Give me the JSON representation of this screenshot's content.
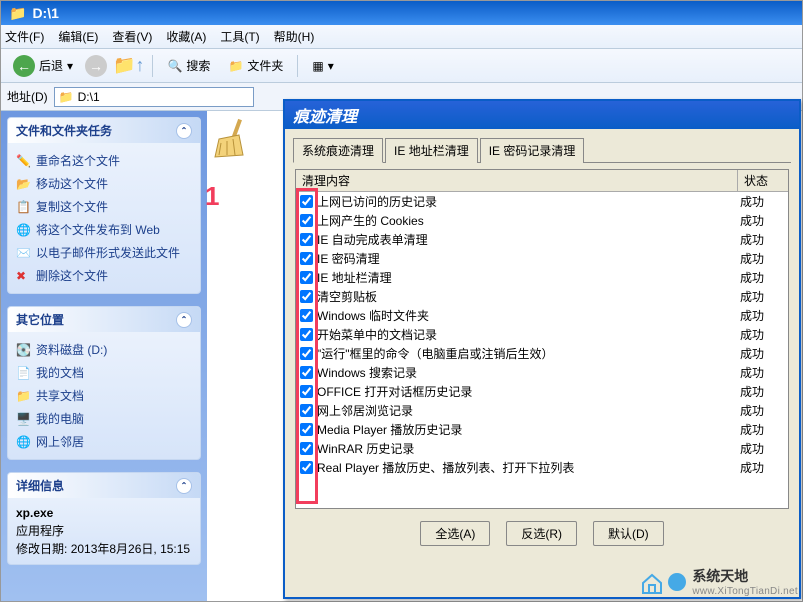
{
  "window": {
    "title": "D:\\1"
  },
  "menu": {
    "file": "文件(F)",
    "edit": "编辑(E)",
    "view": "查看(V)",
    "favorites": "收藏(A)",
    "tools": "工具(T)",
    "help": "帮助(H)"
  },
  "toolbar": {
    "back": "后退",
    "search": "搜索",
    "folders": "文件夹"
  },
  "addressbar": {
    "label": "地址(D)",
    "value": "D:\\1"
  },
  "sidebar": {
    "tasks": {
      "title": "文件和文件夹任务",
      "items": [
        {
          "icon": "rename-icon",
          "label": "重命名这个文件"
        },
        {
          "icon": "move-icon",
          "label": "移动这个文件"
        },
        {
          "icon": "copy-icon",
          "label": "复制这个文件"
        },
        {
          "icon": "web-icon",
          "label": "将这个文件发布到 Web"
        },
        {
          "icon": "email-icon",
          "label": "以电子邮件形式发送此文件"
        },
        {
          "icon": "delete-icon",
          "label": "删除这个文件"
        }
      ]
    },
    "places": {
      "title": "其它位置",
      "items": [
        {
          "icon": "disk-icon",
          "label": "资料磁盘 (D:)"
        },
        {
          "icon": "docs-icon",
          "label": "我的文档"
        },
        {
          "icon": "shared-icon",
          "label": "共享文档"
        },
        {
          "icon": "computer-icon",
          "label": "我的电脑"
        },
        {
          "icon": "network-icon",
          "label": "网上邻居"
        }
      ]
    },
    "details": {
      "title": "详细信息",
      "filename": "xp.exe",
      "type": "应用程序",
      "modified_label": "修改日期:",
      "modified_value": "2013年8月26日, 15:15"
    }
  },
  "content": {
    "marker": "1"
  },
  "dialog": {
    "title": "痕迹清理",
    "tabs": [
      "系统痕迹清理",
      "IE 地址栏清理",
      "IE 密码记录清理"
    ],
    "columns": {
      "name": "清理内容",
      "status": "状态"
    },
    "success": "成功",
    "items": [
      {
        "checked": true,
        "label": "上网已访问的历史记录"
      },
      {
        "checked": true,
        "label": "上网产生的 Cookies"
      },
      {
        "checked": true,
        "label": "IE 自动完成表单清理"
      },
      {
        "checked": true,
        "label": "IE 密码清理"
      },
      {
        "checked": true,
        "label": "IE 地址栏清理"
      },
      {
        "checked": true,
        "label": "清空剪贴板"
      },
      {
        "checked": true,
        "label": "Windows 临时文件夹"
      },
      {
        "checked": true,
        "label": "开始菜单中的文档记录"
      },
      {
        "checked": true,
        "label": "\"运行\"框里的命令（电脑重启或注销后生效）"
      },
      {
        "checked": true,
        "label": "Windows 搜索记录"
      },
      {
        "checked": true,
        "label": "OFFICE 打开对话框历史记录"
      },
      {
        "checked": true,
        "label": "网上邻居浏览记录"
      },
      {
        "checked": true,
        "label": "Media Player 播放历史记录"
      },
      {
        "checked": true,
        "label": "WinRAR 历史记录"
      },
      {
        "checked": true,
        "label": "Real Player 播放历史、播放列表、打开下拉列表"
      }
    ],
    "buttons": {
      "select_all": "全选(A)",
      "invert": "反选(R)",
      "default": "默认(D)"
    }
  },
  "watermark": {
    "name": "系统天地",
    "url": "www.XiTongTianDi.net"
  }
}
